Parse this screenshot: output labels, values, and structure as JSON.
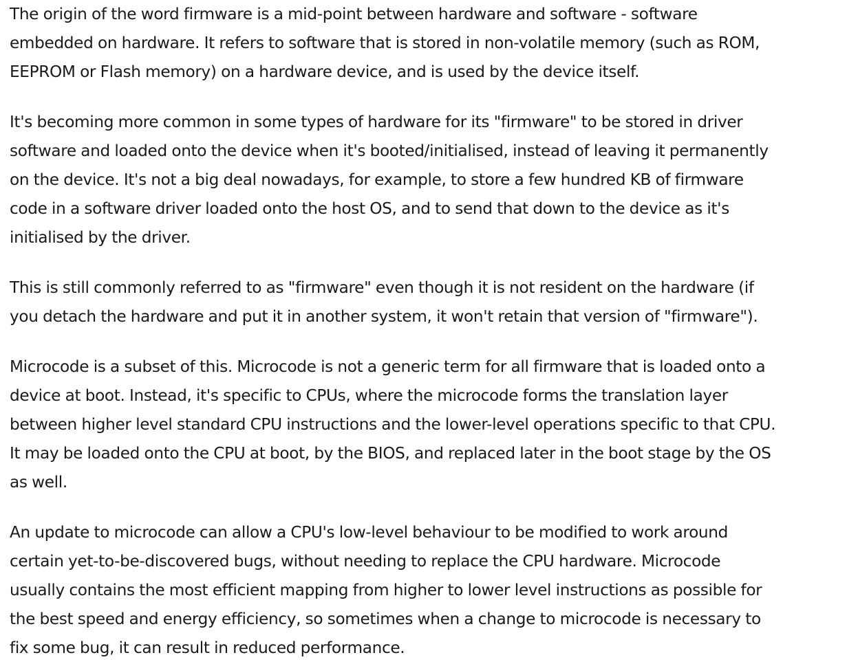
{
  "article": {
    "paragraphs": [
      {
        "lines": [
          "The origin of the word firmware is a mid-point between hardware and software - software",
          "embedded on hardware. It refers to software that is stored in non-volatile memory (such as ROM,",
          "EEPROM or Flash memory) on a hardware device, and is used by the device itself."
        ]
      },
      {
        "lines": [
          "It's becoming more common in some types of hardware for its \"firmware\" to be stored in driver",
          "software and loaded onto the device when it's booted/initialised, instead of leaving it permanently",
          "on the device. It's not a big deal nowadays, for example, to store a few hundred KB of firmware",
          "code in a software driver loaded onto the host OS, and to send that down to the device as it's",
          "initialised by the driver."
        ]
      },
      {
        "lines": [
          "This is still commonly referred to as \"firmware\" even though it is not resident on the hardware (if",
          "you detach the hardware and put it in another system, it won't retain that version of \"firmware\")."
        ]
      },
      {
        "lines": [
          "Microcode is a subset of this. Microcode is not a generic term for all firmware that is loaded onto a",
          "device at boot. Instead, it's specific to CPUs, where the microcode forms the translation layer",
          "between higher level standard CPU instructions and the lower-level operations specific to that CPU.",
          "It may be loaded onto the CPU at boot, by the BIOS, and replaced later in the boot stage by the OS",
          "as well."
        ]
      },
      {
        "lines": [
          "An update to microcode can allow a CPU's low-level behaviour to be modified to work around",
          "certain yet-to-be-discovered bugs, without needing to replace the CPU hardware. Microcode",
          "usually contains the most efficient mapping from higher to lower level instructions as possible for",
          "the best speed and energy efficiency, so sometimes when a change to microcode is necessary to",
          "fix some bug, it can result in reduced performance."
        ]
      }
    ]
  }
}
